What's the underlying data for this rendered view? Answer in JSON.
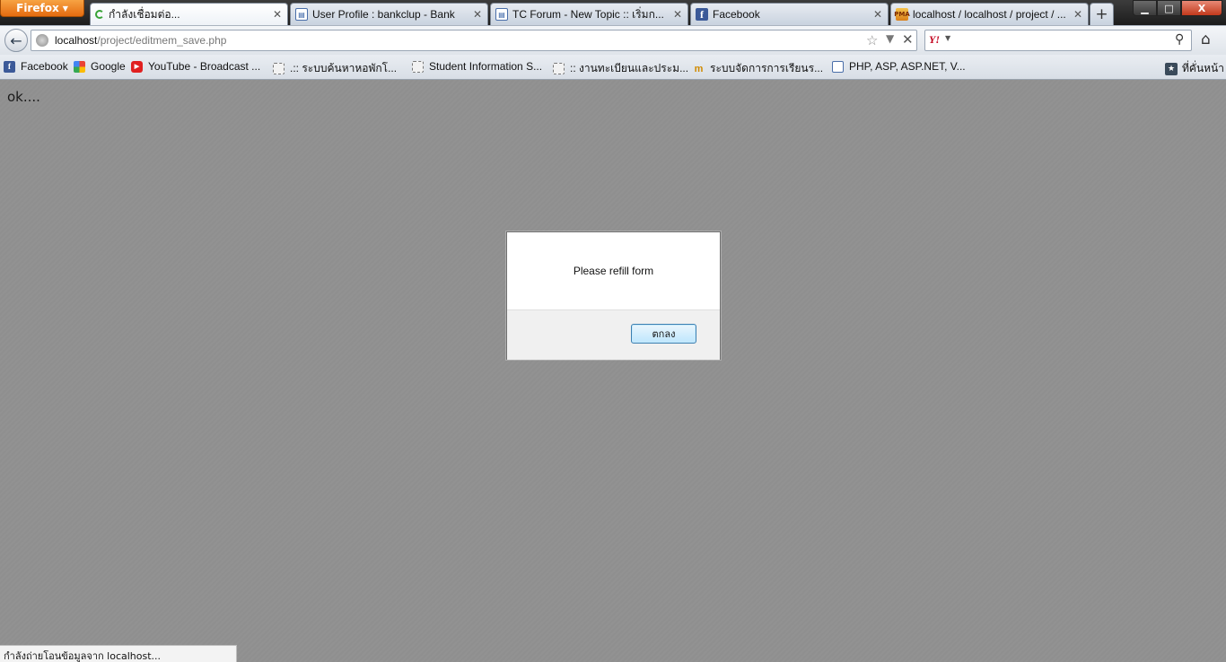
{
  "browser": {
    "menu_button": "Firefox",
    "tabs": [
      {
        "label": "กำลังเชื่อมต่อ...",
        "icon": "loading-spinner-icon",
        "active": true
      },
      {
        "label": "User Profile : bankclup - Bank",
        "icon": "page-icon"
      },
      {
        "label": "TC Forum - New Topic :: เริ่มก...",
        "icon": "page-icon"
      },
      {
        "label": "Facebook",
        "icon": "facebook-icon"
      },
      {
        "label": "localhost / localhost / project / ...",
        "icon": "phpmyadmin-icon"
      }
    ],
    "new_tab": "+",
    "window_controls": {
      "minimize": "▁",
      "maximize": "□",
      "close": "X"
    }
  },
  "navbar": {
    "url_host": "localhost",
    "url_path": "/project/editmem_save.php",
    "search_engine": "Y!"
  },
  "bookmarks": {
    "items": [
      {
        "label": "Facebook",
        "icon": "facebook-icon"
      },
      {
        "label": "Google",
        "icon": "google-icon"
      },
      {
        "label": "YouTube - Broadcast ...",
        "icon": "youtube-icon"
      },
      {
        "label": ".:: ระบบค้นหาหอพักโ...",
        "icon": "blank-page-icon"
      },
      {
        "label": "Student Information S...",
        "icon": "blank-page-icon"
      },
      {
        "label": ":: งานทะเบียนและประม...",
        "icon": "blank-page-icon"
      },
      {
        "label": "ระบบจัดการการเรียนร...",
        "icon": "moodle-icon"
      },
      {
        "label": "PHP, ASP, ASP.NET, V...",
        "icon": "page-icon"
      }
    ],
    "other": "ที่คั่นหน้า"
  },
  "page": {
    "text": "ok...."
  },
  "dialog": {
    "message": "Please refill form",
    "ok_label": "ตกลง"
  },
  "status": {
    "text": "กำลังถ่ายโอนข้อมูลจาก localhost..."
  }
}
